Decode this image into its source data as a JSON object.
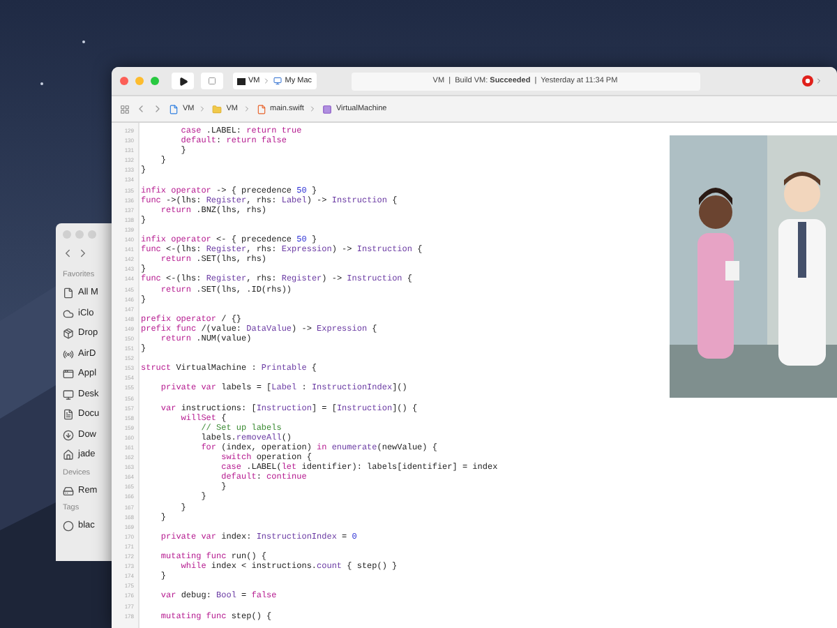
{
  "finder": {
    "sidebar": [
      {
        "heading": "Favorites",
        "items": [
          "All M",
          "iClo",
          "Drop",
          "AirD",
          "Appl",
          "Desk",
          "Docu",
          "Dow",
          "jade"
        ]
      },
      {
        "heading": "Devices",
        "items": [
          "Rem"
        ]
      },
      {
        "heading": "Tags",
        "items": [
          "blac"
        ]
      }
    ]
  },
  "xcode": {
    "toolbar": {
      "scheme": {
        "project": "VM",
        "destination": "My Mac"
      },
      "activity": "VM  |  Build VM: **Succeeded**  |  Yesterday at 11:34 PM"
    },
    "jump_bar": [
      "VM",
      "VM",
      "main.swift",
      "VirtualMachine"
    ],
    "editor": {
      "lines": [
        {
          "number": "129",
          "tokens": [
            {
              "kind": "keyword",
              "text": "        case"
            },
            {
              "kind": "plain",
              "text": " .LABEL: "
            },
            {
              "kind": "keyword",
              "text": "return true"
            }
          ]
        },
        {
          "number": "130",
          "tokens": [
            {
              "kind": "keyword",
              "text": "        default"
            },
            {
              "kind": "plain",
              "text": ": "
            },
            {
              "kind": "keyword",
              "text": "return false"
            }
          ]
        },
        {
          "number": "131",
          "tokens": [
            {
              "kind": "plain",
              "text": "        }"
            }
          ]
        },
        {
          "number": "132",
          "tokens": [
            {
              "kind": "plain",
              "text": "    }"
            }
          ]
        },
        {
          "number": "133",
          "tokens": [
            {
              "kind": "plain",
              "text": "}"
            }
          ]
        },
        {
          "number": "134"
        },
        {
          "number": "135",
          "tokens": [
            {
              "kind": "keyword",
              "text": "infix operator"
            },
            {
              "kind": "plain",
              "text": " -> { precedence "
            },
            {
              "kind": "number",
              "text": "50"
            },
            {
              "kind": "plain",
              "text": " }"
            }
          ]
        },
        {
          "number": "136",
          "tokens": [
            {
              "kind": "keyword",
              "text": "func"
            },
            {
              "kind": "plain",
              "text": " ->(lhs: "
            },
            {
              "kind": "type",
              "text": "Register"
            },
            {
              "kind": "plain",
              "text": ", rhs: "
            },
            {
              "kind": "type",
              "text": "Label"
            },
            {
              "kind": "plain",
              "text": ") -> "
            },
            {
              "kind": "type",
              "text": "Instruction"
            },
            {
              "kind": "plain",
              "text": " {"
            }
          ]
        },
        {
          "number": "137",
          "tokens": [
            {
              "kind": "keyword",
              "text": "    return"
            },
            {
              "kind": "plain",
              "text": " .BNZ(lhs, rhs)"
            }
          ]
        },
        {
          "number": "138",
          "tokens": [
            {
              "kind": "plain",
              "text": "}"
            }
          ]
        },
        {
          "number": "139"
        },
        {
          "number": "140",
          "tokens": [
            {
              "kind": "keyword",
              "text": "infix operator"
            },
            {
              "kind": "plain",
              "text": " <- { precedence "
            },
            {
              "kind": "number",
              "text": "50"
            },
            {
              "kind": "plain",
              "text": " }"
            }
          ]
        },
        {
          "number": "141",
          "tokens": [
            {
              "kind": "keyword",
              "text": "func"
            },
            {
              "kind": "plain",
              "text": " <-(lhs: "
            },
            {
              "kind": "type",
              "text": "Register"
            },
            {
              "kind": "plain",
              "text": ", rhs: "
            },
            {
              "kind": "type",
              "text": "Expression"
            },
            {
              "kind": "plain",
              "text": ") -> "
            },
            {
              "kind": "type",
              "text": "Instruction"
            },
            {
              "kind": "plain",
              "text": " {"
            }
          ]
        },
        {
          "number": "142",
          "tokens": [
            {
              "kind": "keyword",
              "text": "    return"
            },
            {
              "kind": "plain",
              "text": " .SET(lhs, rhs)"
            }
          ]
        },
        {
          "number": "143",
          "tokens": [
            {
              "kind": "plain",
              "text": "}"
            }
          ]
        },
        {
          "number": "144",
          "tokens": [
            {
              "kind": "keyword",
              "text": "func"
            },
            {
              "kind": "plain",
              "text": " <-(lhs: "
            },
            {
              "kind": "type",
              "text": "Register"
            },
            {
              "kind": "plain",
              "text": ", rhs: "
            },
            {
              "kind": "type",
              "text": "Register"
            },
            {
              "kind": "plain",
              "text": ") -> "
            },
            {
              "kind": "type",
              "text": "Instruction"
            },
            {
              "kind": "plain",
              "text": " {"
            }
          ]
        },
        {
          "number": "145",
          "tokens": [
            {
              "kind": "keyword",
              "text": "    return"
            },
            {
              "kind": "plain",
              "text": " .SET(lhs, .ID(rhs))"
            }
          ]
        },
        {
          "number": "146",
          "tokens": [
            {
              "kind": "plain",
              "text": "}"
            }
          ]
        },
        {
          "number": "147"
        },
        {
          "number": "148",
          "tokens": [
            {
              "kind": "keyword",
              "text": "prefix operator"
            },
            {
              "kind": "plain",
              "text": " / {}"
            }
          ]
        },
        {
          "number": "149",
          "tokens": [
            {
              "kind": "keyword",
              "text": "prefix func"
            },
            {
              "kind": "plain",
              "text": " /(value: "
            },
            {
              "kind": "type",
              "text": "DataValue"
            },
            {
              "kind": "plain",
              "text": ") -> "
            },
            {
              "kind": "type",
              "text": "Expression"
            },
            {
              "kind": "plain",
              "text": " {"
            }
          ]
        },
        {
          "number": "150",
          "tokens": [
            {
              "kind": "keyword",
              "text": "    return"
            },
            {
              "kind": "plain",
              "text": " .NUM(value)"
            }
          ]
        },
        {
          "number": "151",
          "tokens": [
            {
              "kind": "plain",
              "text": "}"
            }
          ]
        },
        {
          "number": "152"
        },
        {
          "number": "153",
          "tokens": [
            {
              "kind": "keyword",
              "text": "struct"
            },
            {
              "kind": "plain",
              "text": " VirtualMachine : "
            },
            {
              "kind": "type",
              "text": "Printable"
            },
            {
              "kind": "plain",
              "text": " {"
            }
          ]
        },
        {
          "number": "154"
        },
        {
          "number": "155",
          "tokens": [
            {
              "kind": "keyword",
              "text": "    private var"
            },
            {
              "kind": "plain",
              "text": " labels = ["
            },
            {
              "kind": "type",
              "text": "Label"
            },
            {
              "kind": "plain",
              "text": " : "
            },
            {
              "kind": "type",
              "text": "InstructionIndex"
            },
            {
              "kind": "plain",
              "text": "]()"
            }
          ]
        },
        {
          "number": "156"
        },
        {
          "number": "157",
          "tokens": [
            {
              "kind": "keyword",
              "text": "    var"
            },
            {
              "kind": "plain",
              "text": " instructions: ["
            },
            {
              "kind": "type",
              "text": "Instruction"
            },
            {
              "kind": "plain",
              "text": "] = ["
            },
            {
              "kind": "type",
              "text": "Instruction"
            },
            {
              "kind": "plain",
              "text": "]() {"
            }
          ]
        },
        {
          "number": "158",
          "tokens": [
            {
              "kind": "keyword",
              "text": "        willSet"
            },
            {
              "kind": "plain",
              "text": " {"
            }
          ]
        },
        {
          "number": "159",
          "tokens": [
            {
              "kind": "comment",
              "text": "            // Set up labels"
            }
          ]
        },
        {
          "number": "160",
          "tokens": [
            {
              "kind": "plain",
              "text": "            labels."
            },
            {
              "kind": "type",
              "text": "removeAll"
            },
            {
              "kind": "plain",
              "text": "()"
            }
          ]
        },
        {
          "number": "161",
          "tokens": [
            {
              "kind": "keyword",
              "text": "            for"
            },
            {
              "kind": "plain",
              "text": " (index, operation) "
            },
            {
              "kind": "keyword",
              "text": "in"
            },
            {
              "kind": "type",
              "text": " enumerate"
            },
            {
              "kind": "plain",
              "text": "(newValue) {"
            }
          ]
        },
        {
          "number": "162",
          "tokens": [
            {
              "kind": "keyword",
              "text": "                switch"
            },
            {
              "kind": "plain",
              "text": " operation {"
            }
          ]
        },
        {
          "number": "163",
          "tokens": [
            {
              "kind": "keyword",
              "text": "                case"
            },
            {
              "kind": "plain",
              "text": " .LABEL("
            },
            {
              "kind": "keyword",
              "text": "let"
            },
            {
              "kind": "plain",
              "text": " identifier): labels[identifier] = index"
            }
          ]
        },
        {
          "number": "164",
          "tokens": [
            {
              "kind": "keyword",
              "text": "                default"
            },
            {
              "kind": "plain",
              "text": ": "
            },
            {
              "kind": "keyword",
              "text": "continue"
            }
          ]
        },
        {
          "number": "165",
          "tokens": [
            {
              "kind": "plain",
              "text": "                }"
            }
          ]
        },
        {
          "number": "166",
          "tokens": [
            {
              "kind": "plain",
              "text": "            }"
            }
          ]
        },
        {
          "number": "167",
          "tokens": [
            {
              "kind": "plain",
              "text": "        }"
            }
          ]
        },
        {
          "number": "168",
          "tokens": [
            {
              "kind": "plain",
              "text": "    }"
            }
          ]
        },
        {
          "number": "169"
        },
        {
          "number": "170",
          "tokens": [
            {
              "kind": "keyword",
              "text": "    private var"
            },
            {
              "kind": "plain",
              "text": " index: "
            },
            {
              "kind": "type",
              "text": "InstructionIndex"
            },
            {
              "kind": "plain",
              "text": " = "
            },
            {
              "kind": "number",
              "text": "0"
            }
          ]
        },
        {
          "number": "171"
        },
        {
          "number": "172",
          "tokens": [
            {
              "kind": "keyword",
              "text": "    mutating func"
            },
            {
              "kind": "plain",
              "text": " run() {"
            }
          ]
        },
        {
          "number": "173",
          "tokens": [
            {
              "kind": "keyword",
              "text": "        while"
            },
            {
              "kind": "plain",
              "text": " index < instructions."
            },
            {
              "kind": "type",
              "text": "count"
            },
            {
              "kind": "plain",
              "text": " { step() }"
            }
          ]
        },
        {
          "number": "174",
          "tokens": [
            {
              "kind": "plain",
              "text": "    }"
            }
          ]
        },
        {
          "number": "175"
        },
        {
          "number": "176",
          "tokens": [
            {
              "kind": "keyword",
              "text": "    var"
            },
            {
              "kind": "plain",
              "text": " debug: "
            },
            {
              "kind": "type",
              "text": "Bool"
            },
            {
              "kind": "plain",
              "text": " = "
            },
            {
              "kind": "keyword",
              "text": "false"
            }
          ]
        },
        {
          "number": "177"
        },
        {
          "number": "178",
          "tokens": [
            {
              "kind": "keyword",
              "text": "    mutating func"
            },
            {
              "kind": "plain",
              "text": " step() {"
            }
          ]
        }
      ]
    }
  }
}
